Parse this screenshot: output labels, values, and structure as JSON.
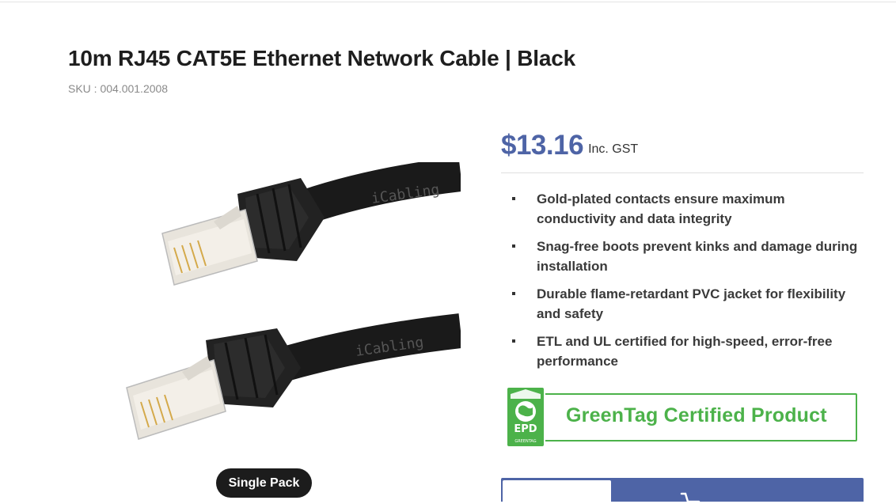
{
  "product": {
    "title": "10m RJ45 CAT5E Ethernet Network Cable | Black",
    "sku": "SKU : 004.001.2008",
    "image_alt": "ethernet-cable-image",
    "cable_print": "iCabling"
  },
  "variant": {
    "pack_label": "Single Pack"
  },
  "pricing": {
    "price": "$13.16",
    "suffix": "Inc. GST"
  },
  "features": [
    "Gold-plated contacts ensure maximum conductivity and data integrity",
    "Snag-free boots prevent kinks and damage during installation",
    "Durable flame-retardant PVC jacket for flexibility and safety",
    "ETL and UL certified for high-speed, error-free performance"
  ],
  "certification": {
    "label": "GreenTag Certified Product",
    "logo_text": "EPD",
    "logo_subtext": "GREENTAG"
  },
  "cart": {
    "icon": "cart-icon"
  },
  "colors": {
    "accent": "#4e64a6",
    "green": "#4cb24a",
    "dark_button": "#1c1c1c"
  }
}
